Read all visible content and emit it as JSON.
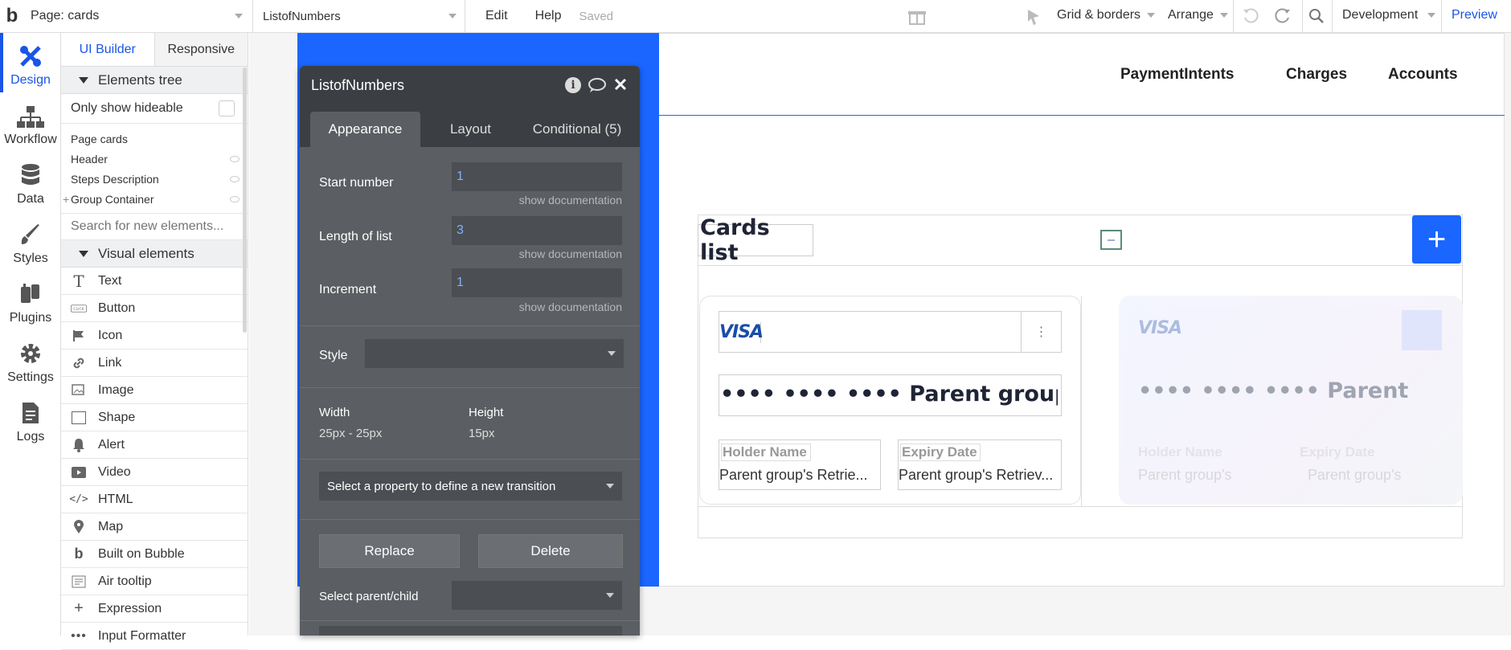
{
  "topbar": {
    "logo": "b",
    "page_label": "Page: cards",
    "element_selector": "ListofNumbers",
    "edit": "Edit",
    "help": "Help",
    "saved": "Saved",
    "grid_borders": "Grid & borders",
    "arrange": "Arrange",
    "development": "Development",
    "preview": "Preview"
  },
  "iconbar": {
    "items": [
      {
        "label": "Design",
        "icon": "design-icon"
      },
      {
        "label": "Workflow",
        "icon": "workflow-icon"
      },
      {
        "label": "Data",
        "icon": "database-icon"
      },
      {
        "label": "Styles",
        "icon": "brush-icon"
      },
      {
        "label": "Plugins",
        "icon": "plug-icon"
      },
      {
        "label": "Settings",
        "icon": "gear-icon"
      },
      {
        "label": "Logs",
        "icon": "document-icon"
      }
    ]
  },
  "palette": {
    "tabs": [
      "UI Builder",
      "Responsive"
    ],
    "elements_tree": "Elements tree",
    "only_show_hideable": "Only show hideable",
    "tree": [
      "Page cards",
      "Header",
      "Steps Description",
      "Group Container"
    ],
    "search_placeholder": "Search for new elements...",
    "visual_elements": "Visual elements",
    "elements": [
      {
        "label": "Text",
        "icon": "text-icon"
      },
      {
        "label": "Button",
        "icon": "button-icon"
      },
      {
        "label": "Icon",
        "icon": "flag-icon"
      },
      {
        "label": "Link",
        "icon": "link-icon"
      },
      {
        "label": "Image",
        "icon": "image-icon"
      },
      {
        "label": "Shape",
        "icon": "shape-icon"
      },
      {
        "label": "Alert",
        "icon": "bell-icon"
      },
      {
        "label": "Video",
        "icon": "video-icon"
      },
      {
        "label": "HTML",
        "icon": "code-icon"
      },
      {
        "label": "Map",
        "icon": "map-pin-icon"
      },
      {
        "label": "Built on Bubble",
        "icon": "bubble-icon"
      },
      {
        "label": "Air tooltip",
        "icon": "tooltip-icon"
      },
      {
        "label": "Expression",
        "icon": "plus-icon"
      },
      {
        "label": "Input Formatter",
        "icon": "ellipsis-icon"
      }
    ]
  },
  "canvas": {
    "nav": [
      "PaymentIntents",
      "Charges",
      "Accounts"
    ],
    "cards_title": "Cards list",
    "add_button": "+",
    "card1": {
      "brand": "VISA",
      "number": "•••• •••• •••• Parent group's...",
      "holder_label": "Holder Name",
      "holder_value": "Parent group's Retrie...",
      "expiry_label": "Expiry Date",
      "expiry_value": "Parent group's Retriev..."
    },
    "card2": {
      "brand": "VISA",
      "number": "•••• •••• •••• Parent",
      "holder_label": "Holder Name",
      "holder_value": "Parent group's",
      "expiry_label": "Expiry Date",
      "expiry_value": "Parent group's"
    }
  },
  "editor": {
    "title": "ListofNumbers",
    "tabs": [
      "Appearance",
      "Layout",
      "Conditional (5)"
    ],
    "start_number_label": "Start number",
    "start_number": "1",
    "length_label": "Length of list",
    "length": "3",
    "increment_label": "Increment",
    "increment": "1",
    "show_documentation": "show documentation",
    "style_label": "Style",
    "width_label": "Width",
    "width_value": "25px - 25px",
    "height_label": "Height",
    "height_value": "15px",
    "transition": "Select a property to define a new transition",
    "replace": "Replace",
    "delete": "Delete",
    "parent_child_label": "Select parent/child"
  }
}
